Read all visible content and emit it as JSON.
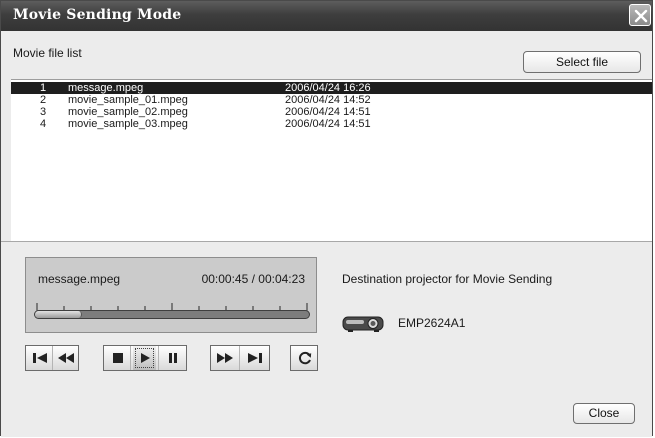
{
  "window": {
    "title": "Movie Sending Mode"
  },
  "header": {
    "list_label": "Movie file list",
    "select_button": "Select file"
  },
  "files": [
    {
      "num": "1",
      "name": "message.mpeg",
      "date": "2006/04/24 16:26",
      "selected": true
    },
    {
      "num": "2",
      "name": "movie_sample_01.mpeg",
      "date": "2006/04/24 14:52",
      "selected": false
    },
    {
      "num": "3",
      "name": "movie_sample_02.mpeg",
      "date": "2006/04/24 14:51",
      "selected": false
    },
    {
      "num": "4",
      "name": "movie_sample_03.mpeg",
      "date": "2006/04/24 14:51",
      "selected": false
    }
  ],
  "player": {
    "file": "message.mpeg",
    "time": "00:00:45 / 00:04:23",
    "progress": 0.17
  },
  "controls": [
    {
      "name": "skip-to-start-button",
      "icon": "skip-start-icon"
    },
    {
      "name": "rewind-button",
      "icon": "rewind-icon"
    },
    {
      "name": "stop-button",
      "icon": "stop-icon"
    },
    {
      "name": "play-button",
      "icon": "play-icon",
      "active": true
    },
    {
      "name": "pause-button",
      "icon": "pause-icon"
    },
    {
      "name": "fast-forward-button",
      "icon": "fast-forward-icon"
    },
    {
      "name": "skip-to-end-button",
      "icon": "skip-end-icon"
    },
    {
      "name": "repeat-button",
      "icon": "repeat-icon"
    }
  ],
  "destination": {
    "label": "Destination projector for Movie Sending",
    "projector_name": "EMP2624A1"
  },
  "footer": {
    "close_button": "Close"
  }
}
